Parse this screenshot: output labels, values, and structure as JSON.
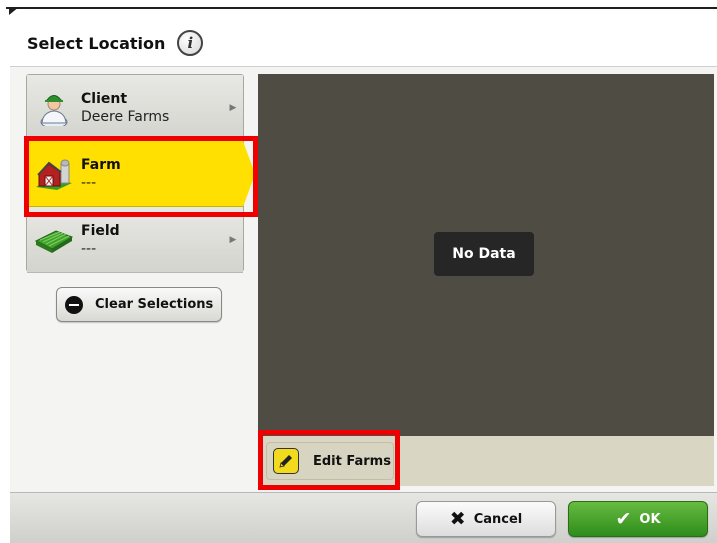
{
  "header": {
    "title": "Select Location",
    "info_icon": "info-icon"
  },
  "nav": {
    "items": [
      {
        "label": "Client",
        "value": "Deere Farms",
        "icon": "person-icon",
        "selected": false,
        "has_arrow": true
      },
      {
        "label": "Farm",
        "value": "---",
        "icon": "barn-icon",
        "selected": true,
        "has_arrow": false
      },
      {
        "label": "Field",
        "value": "---",
        "icon": "field-icon",
        "selected": false,
        "has_arrow": true
      }
    ],
    "arrow_glyph": "▶"
  },
  "clear_button": {
    "label": "Clear Selections",
    "icon": "minus-circle-icon"
  },
  "content": {
    "empty_message": "No Data"
  },
  "toolbar": {
    "edit_label": "Edit Farms",
    "icon": "pencil-icon"
  },
  "footer": {
    "cancel_label": "Cancel",
    "ok_label": "OK",
    "cancel_icon": "close-icon",
    "ok_icon": "checkmark-icon"
  },
  "colors": {
    "selected": "#ffe000",
    "content_bg": "#4f4c43",
    "highlight": "#ee0000",
    "ok_green": "#3f9c24"
  }
}
